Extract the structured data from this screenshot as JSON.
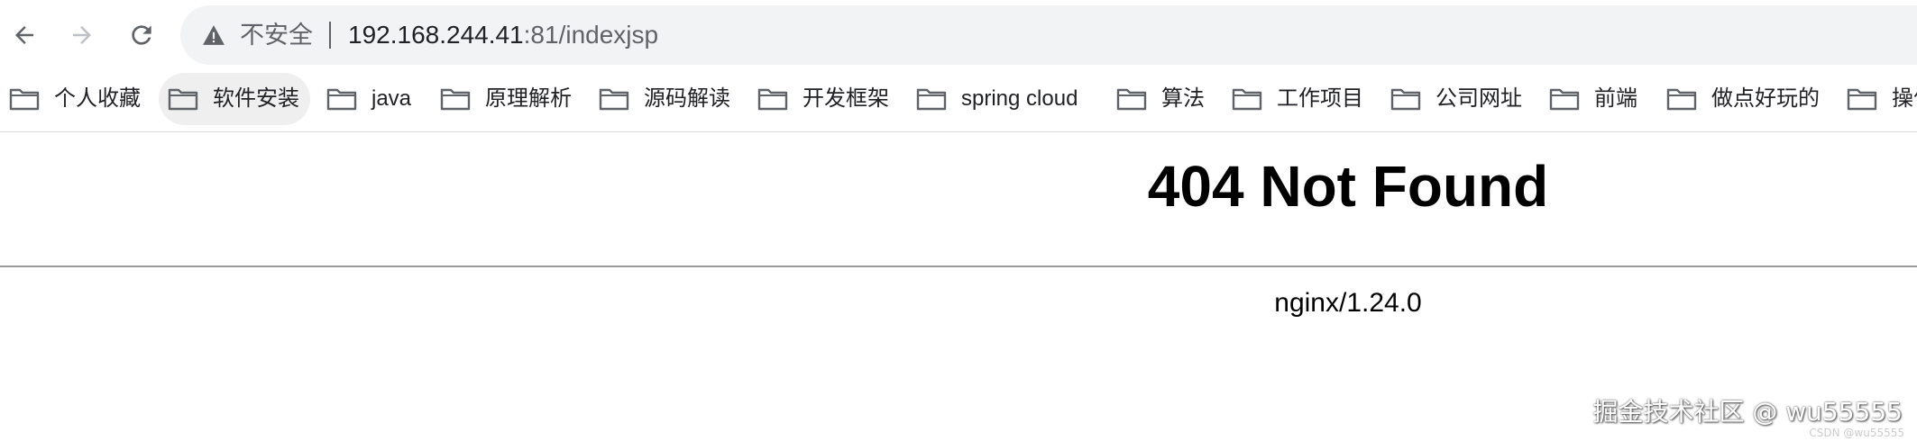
{
  "toolbar": {
    "back_icon": "arrow-left-icon",
    "forward_icon": "arrow-right-icon",
    "reload_icon": "reload-icon",
    "security_icon": "warning-triangle-icon",
    "security_label": "不安全",
    "url_host": "192.168.244.41",
    "url_rest": ":81/indexjsp"
  },
  "bookmarks": [
    {
      "label": "个人收藏",
      "icon": "folder-icon"
    },
    {
      "label": "软件安装",
      "icon": "folder-icon"
    },
    {
      "label": "java",
      "icon": "folder-icon"
    },
    {
      "label": "原理解析",
      "icon": "folder-icon"
    },
    {
      "label": "源码解读",
      "icon": "folder-icon"
    },
    {
      "label": "开发框架",
      "icon": "folder-icon"
    },
    {
      "label": "spring cloud",
      "icon": "folder-icon"
    },
    {
      "label": "算法",
      "icon": "folder-icon"
    },
    {
      "label": "工作项目",
      "icon": "folder-icon"
    },
    {
      "label": "公司网址",
      "icon": "folder-icon"
    },
    {
      "label": "前端",
      "icon": "folder-icon"
    },
    {
      "label": "做点好玩的",
      "icon": "folder-icon"
    },
    {
      "label": "操作",
      "icon": "folder-icon"
    }
  ],
  "page": {
    "title": "404 Not Found",
    "server": "nginx/1.24.0"
  },
  "watermark": {
    "main": "掘金技术社区 @ wu55555",
    "small": "CSDN @wu55555"
  },
  "colors": {
    "omnibox_bg": "#f1f3f4",
    "icon_gray": "#5f6368",
    "icon_disabled": "#bdc1c6",
    "text": "#202124"
  }
}
